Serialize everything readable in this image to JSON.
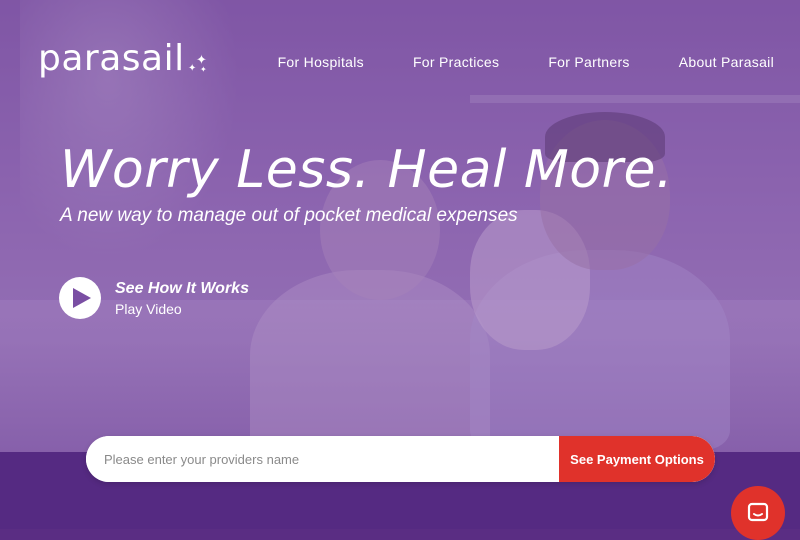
{
  "brand": {
    "logo_text": "parasail",
    "accent_color": "#e0322b",
    "band_color": "#552a82"
  },
  "nav": {
    "items": [
      {
        "label": "For Hospitals"
      },
      {
        "label": "For Practices"
      },
      {
        "label": "For Partners"
      },
      {
        "label": "About Parasail"
      }
    ]
  },
  "hero": {
    "headline": "Worry Less. Heal More.",
    "subheadline": "A new way to manage out of pocket medical expenses",
    "video": {
      "title": "See How It Works",
      "subtitle": "Play Video",
      "icon": "play-icon"
    }
  },
  "search": {
    "placeholder": "Please enter your providers name",
    "value": "",
    "button_label": "See Payment Options"
  },
  "chat": {
    "icon": "chat-icon"
  }
}
